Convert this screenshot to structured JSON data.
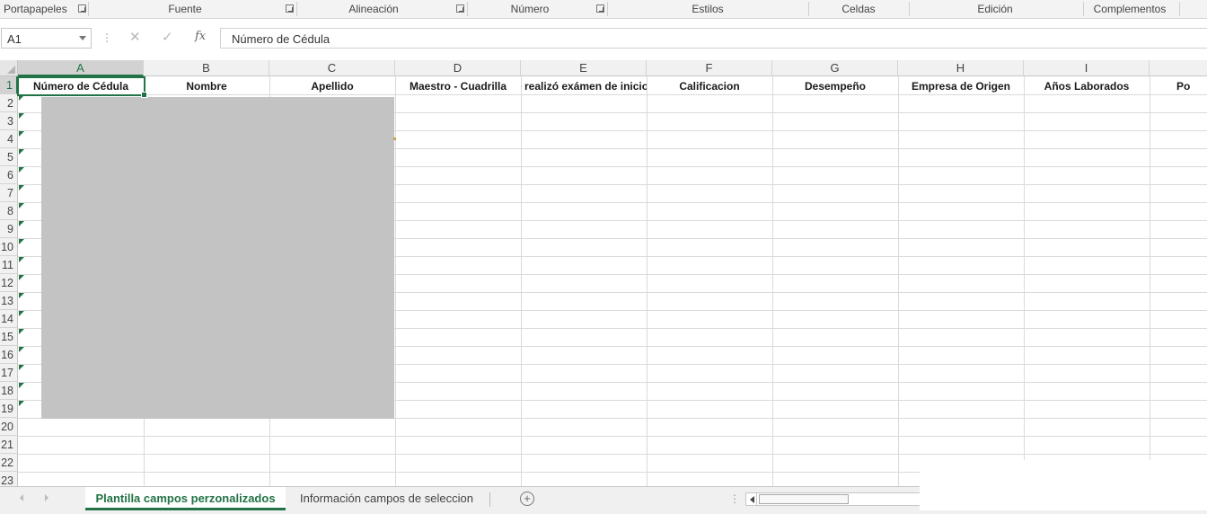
{
  "ribbon": {
    "groups": [
      "Portapapeles",
      "Fuente",
      "Alineación",
      "Número",
      "Estilos",
      "Celdas",
      "Edición",
      "Complementos"
    ]
  },
  "formula_bar": {
    "name_box": "A1",
    "fx_label": "fx",
    "cancel_icon": "✕",
    "enter_icon": "✓",
    "content": "Número de Cédula"
  },
  "grid": {
    "columns": [
      "A",
      "B",
      "C",
      "D",
      "E",
      "F",
      "G",
      "H",
      "I",
      ""
    ],
    "rows": [
      "1",
      "2",
      "3",
      "4",
      "5",
      "6",
      "7",
      "8",
      "9",
      "10",
      "11",
      "12",
      "13",
      "14",
      "15",
      "16",
      "17",
      "18",
      "19",
      "20",
      "21",
      "22",
      "23"
    ],
    "header_cells": [
      "Número de Cédula",
      "Nombre",
      "Apellido",
      "Maestro - Cuadrilla",
      "Se realizó exámen de inicio",
      "Calificacion",
      "Desempeño",
      "Empresa de Origen",
      "Años Laborados",
      "Po"
    ],
    "selected_cell": "A1"
  },
  "sheets": {
    "tabs": [
      "Plantilla campos perzonalizados",
      "Información campos de seleccion"
    ],
    "active_index": 0,
    "add_label": "+"
  },
  "colors": {
    "accent": "#217346",
    "redacted": "#c3c3c3"
  }
}
